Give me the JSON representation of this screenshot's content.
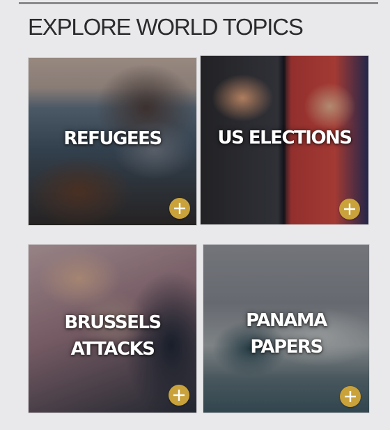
{
  "section": {
    "title": "EXPLORE WORLD TOPICS"
  },
  "topics": [
    {
      "lines": [
        "REFUGEES"
      ],
      "action_icon": "plus-icon"
    },
    {
      "lines": [
        "US ELECTIONS"
      ],
      "action_icon": "plus-icon"
    },
    {
      "lines": [
        "BRUSSELS",
        "ATTACKS"
      ],
      "action_icon": "plus-icon"
    },
    {
      "lines": [
        "PANAMA",
        "PAPERS"
      ],
      "action_icon": "plus-icon"
    }
  ],
  "colors": {
    "background": "#e9e9eb",
    "accent": "#c9a23b",
    "title_text": "#2b2b2d",
    "tile_label": "#ffffff"
  }
}
